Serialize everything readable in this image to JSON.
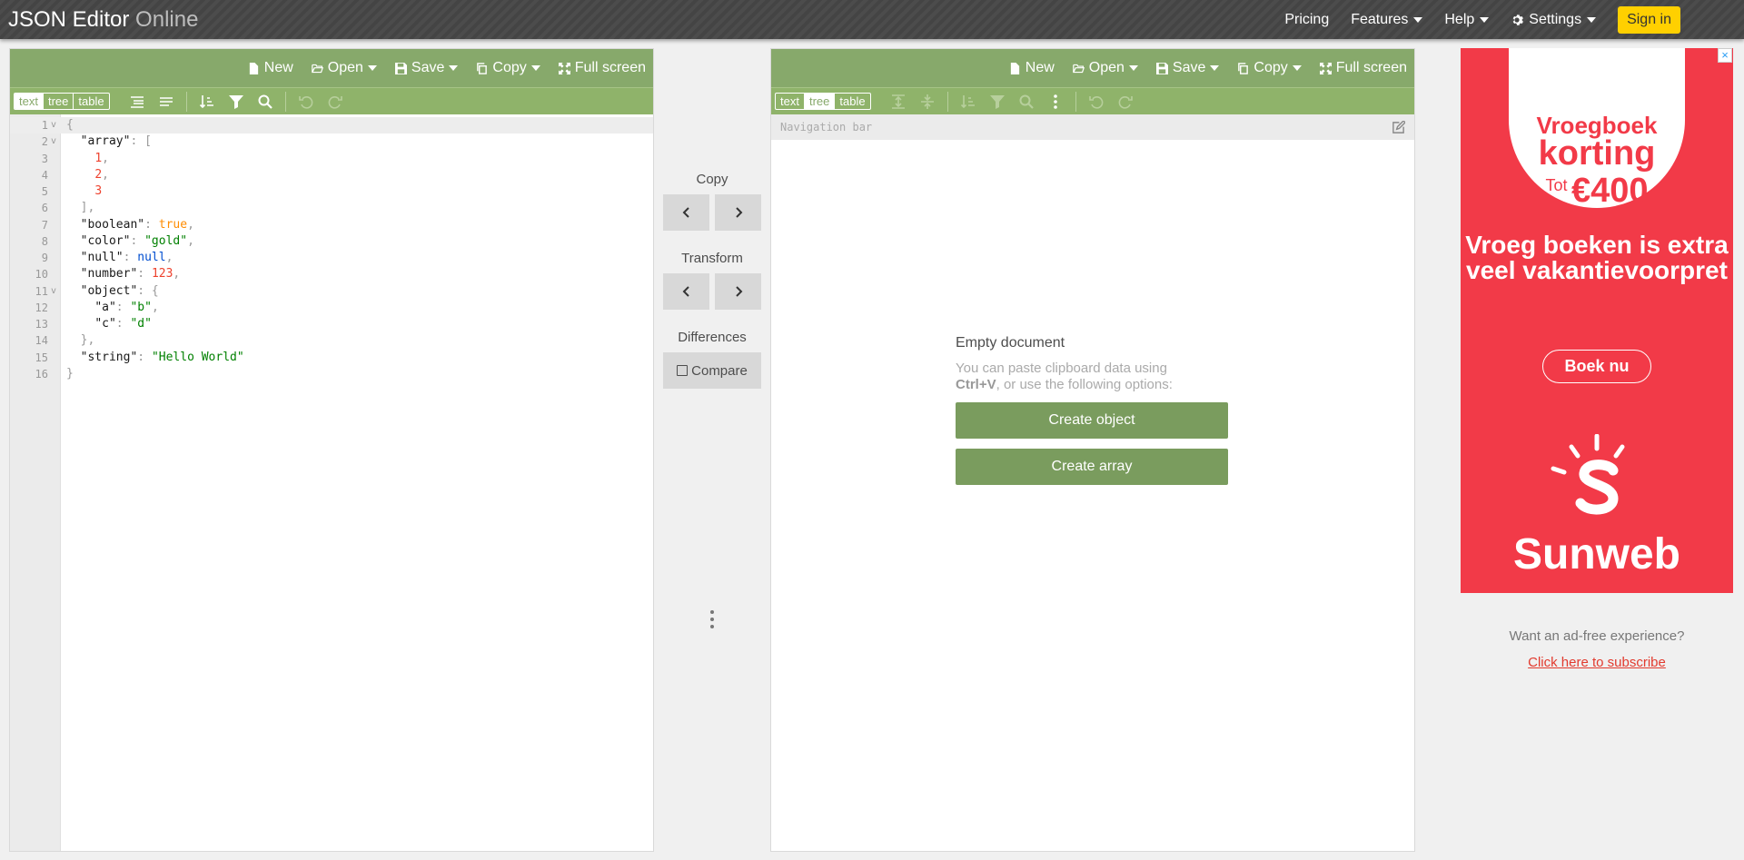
{
  "app": {
    "title_main": "JSON Editor",
    "title_sub": "Online"
  },
  "topnav": {
    "pricing": "Pricing",
    "features": "Features",
    "help": "Help",
    "settings": "Settings",
    "signin": "Sign in"
  },
  "left": {
    "menu": {
      "new": "New",
      "open": "Open",
      "save": "Save",
      "copy": "Copy",
      "fullscreen": "Full screen"
    },
    "modes": [
      "text",
      "tree",
      "table"
    ],
    "active_mode": "text",
    "lines": [
      {
        "n": "1",
        "fold": "v",
        "html": "<span class=\"p\">{</span>"
      },
      {
        "n": "2",
        "fold": "v",
        "html": "  <span class=\"k\">\"array\"</span><span class=\"p\">: [</span>"
      },
      {
        "n": "3",
        "fold": "",
        "html": "    <span class=\"num\">1</span><span class=\"p\">,</span>"
      },
      {
        "n": "4",
        "fold": "",
        "html": "    <span class=\"num\">2</span><span class=\"p\">,</span>"
      },
      {
        "n": "5",
        "fold": "",
        "html": "    <span class=\"num\">3</span>"
      },
      {
        "n": "6",
        "fold": "",
        "html": "  <span class=\"p\">],</span>"
      },
      {
        "n": "7",
        "fold": "",
        "html": "  <span class=\"k\">\"boolean\"</span><span class=\"p\">: </span><span class=\"boo\">true</span><span class=\"p\">,</span>"
      },
      {
        "n": "8",
        "fold": "",
        "html": "  <span class=\"k\">\"color\"</span><span class=\"p\">: </span><span class=\"str\">\"gold\"</span><span class=\"p\">,</span>"
      },
      {
        "n": "9",
        "fold": "",
        "html": "  <span class=\"k\">\"null\"</span><span class=\"p\">: </span><span class=\"nul\">null</span><span class=\"p\">,</span>"
      },
      {
        "n": "10",
        "fold": "",
        "html": "  <span class=\"k\">\"number\"</span><span class=\"p\">: </span><span class=\"num\">123</span><span class=\"p\">,</span>"
      },
      {
        "n": "11",
        "fold": "v",
        "html": "  <span class=\"k\">\"object\"</span><span class=\"p\">: {</span>"
      },
      {
        "n": "12",
        "fold": "",
        "html": "    <span class=\"k\">\"a\"</span><span class=\"p\">: </span><span class=\"str\">\"b\"</span><span class=\"p\">,</span>"
      },
      {
        "n": "13",
        "fold": "",
        "html": "    <span class=\"k\">\"c\"</span><span class=\"p\">: </span><span class=\"str\">\"d\"</span>"
      },
      {
        "n": "14",
        "fold": "",
        "html": "  <span class=\"p\">},</span>"
      },
      {
        "n": "15",
        "fold": "",
        "html": "  <span class=\"k\">\"string\"</span><span class=\"p\">: </span><span class=\"str\">\"Hello World\"</span>"
      },
      {
        "n": "16",
        "fold": "",
        "html": "<span class=\"p\">}</span>"
      }
    ]
  },
  "middle": {
    "copy_label": "Copy",
    "transform_label": "Transform",
    "differences_label": "Differences",
    "compare_label": "Compare"
  },
  "right": {
    "menu": {
      "new": "New",
      "open": "Open",
      "save": "Save",
      "copy": "Copy",
      "fullscreen": "Full screen"
    },
    "modes": [
      "text",
      "tree",
      "table"
    ],
    "active_mode": "tree",
    "navbar_placeholder": "Navigation bar",
    "empty_title": "Empty document",
    "empty_desc_1": "You can paste clipboard data using",
    "empty_desc_key": "Ctrl+V",
    "empty_desc_2": ", or use the following options:",
    "create_object": "Create object",
    "create_array": "Create array"
  },
  "ad": {
    "line1": "Vroegboek",
    "line2": "korting",
    "tot": "Tot",
    "amount": "€400",
    "headline": "Vroeg boeken is extra veel vakantievoorpret",
    "cta": "Boek nu",
    "brand": "Sunweb",
    "close": "×",
    "adfree_text": "Want an ad-free experience?",
    "subscribe": "Click here to subscribe"
  },
  "colors": {
    "accent": "#87a96b",
    "topbar": "#464646",
    "signin": "#ffd000",
    "ad_bg": "#f23a48"
  }
}
